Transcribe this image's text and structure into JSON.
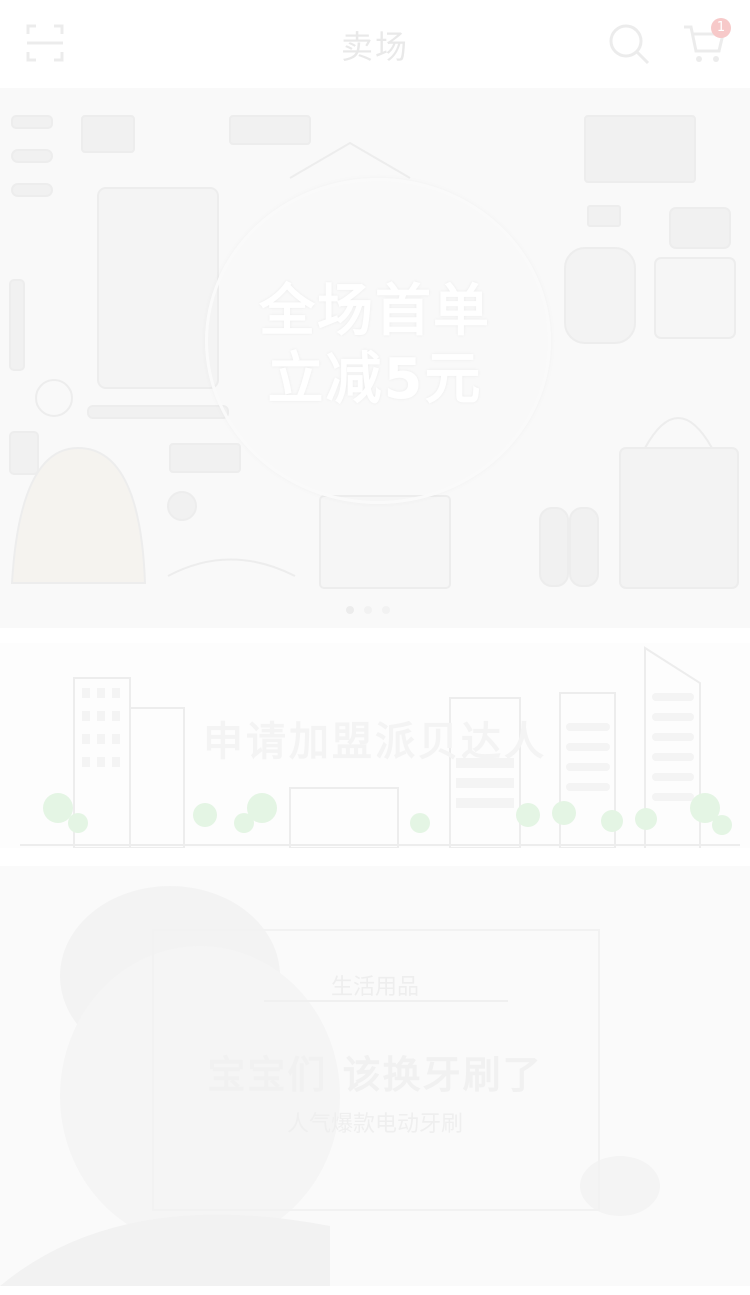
{
  "header": {
    "title": "卖场",
    "cart_badge": "1",
    "icons": [
      "scan-icon",
      "search-icon",
      "cart-icon"
    ]
  },
  "hero_banner": {
    "line1": "全场首单",
    "line2": "立减5元",
    "slide_count": 3,
    "active_slide": 1
  },
  "recruit_banner": {
    "text": "申请加盟派贝达人"
  },
  "product_banner": {
    "category": "生活用品",
    "headline": "宝宝们 该换牙刷了",
    "subtitle": "人气爆款电动牙刷"
  },
  "colors": {
    "background": "#ffffff",
    "badge": "#f7c9c9",
    "tree_green": "#e4f5e4"
  }
}
